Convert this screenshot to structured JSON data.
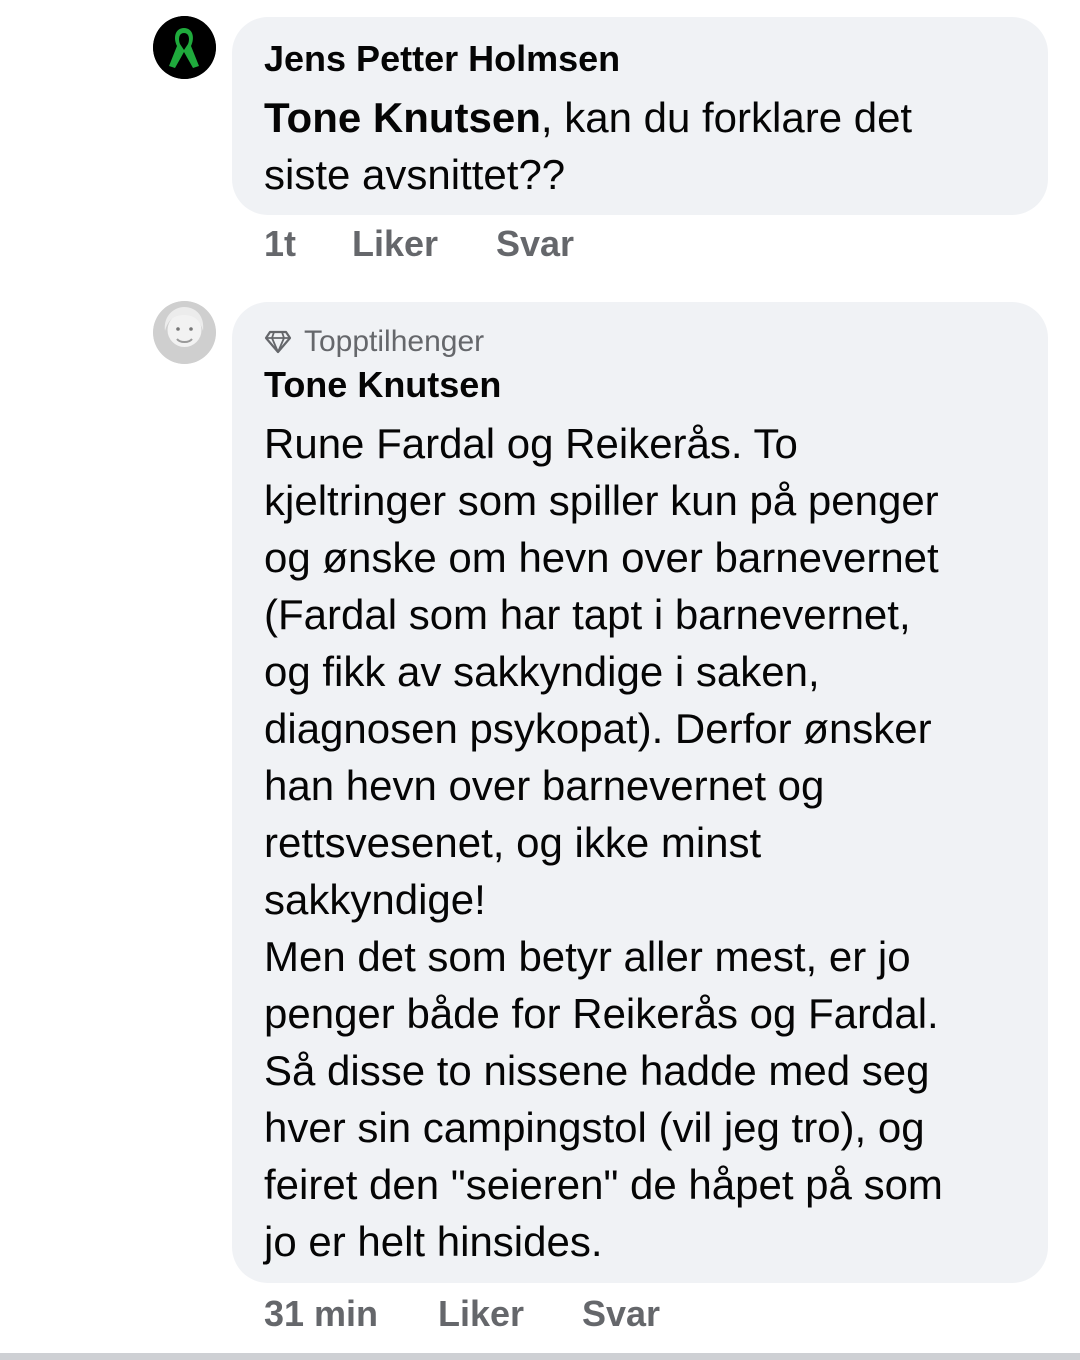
{
  "comments": [
    {
      "author": "Jens Petter Holmsen",
      "mention": "Tone Knutsen",
      "text": ", kan du forklare det\nsiste avsnittet??",
      "time": "1t",
      "like_label": "Liker",
      "reply_label": "Svar"
    },
    {
      "badge": "Topptilhenger",
      "author": "Tone Knutsen",
      "text": "Rune Fardal og Reikerås. To\nkjeltringer som spiller kun på penger\nog ønske om hevn over barnevernet\n(Fardal som har tapt i  barnevernet,\nog fikk av sakkyndige i saken,\ndiagnosen psykopat). Derfor ønsker\nhan hevn over barnevernet og\nrettsvesenet, og ikke minst\nsakkyndige!\nMen det som betyr aller mest, er jo\npenger både for Reikerås og Fardal.\nSå disse to nissene hadde med seg\nhver sin campingstol (vil jeg tro), og\nfeiret den \"seieren\" de håpet på som\njo er helt hinsides.",
      "time": "31 min",
      "like_label": "Liker",
      "reply_label": "Svar"
    }
  ],
  "icons": {
    "badge_icon": "diamond-icon",
    "avatar_1": "green-ribbon-avatar",
    "avatar_2": "profile-photo-avatar"
  },
  "colors": {
    "bubble_bg": "#f0f2f5",
    "text": "#050505",
    "secondary_text": "#65676b",
    "avatar_ribbon": "#1faa3c"
  }
}
